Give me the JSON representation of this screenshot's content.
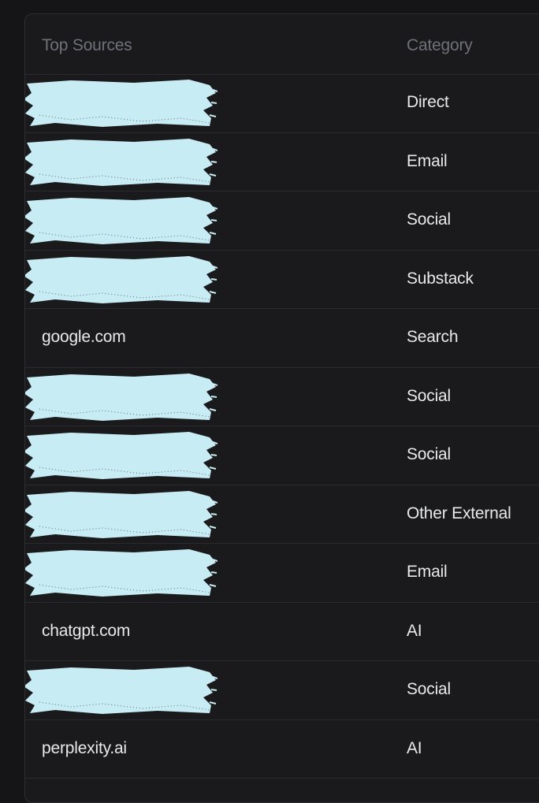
{
  "table": {
    "headers": {
      "source": "Top Sources",
      "category": "Category"
    },
    "rows": [
      {
        "source": "",
        "redacted": true,
        "category": "Direct"
      },
      {
        "source": "",
        "redacted": true,
        "category": "Email"
      },
      {
        "source": "",
        "redacted": true,
        "category": "Social"
      },
      {
        "source": "",
        "redacted": true,
        "category": "Substack"
      },
      {
        "source": "google.com",
        "redacted": false,
        "category": "Search"
      },
      {
        "source": "",
        "redacted": true,
        "category": "Social"
      },
      {
        "source": "",
        "redacted": true,
        "category": "Social"
      },
      {
        "source": "",
        "redacted": true,
        "category": "Other External"
      },
      {
        "source": "",
        "redacted": true,
        "category": "Email"
      },
      {
        "source": "chatgpt.com",
        "redacted": false,
        "category": "AI"
      },
      {
        "source": "",
        "redacted": true,
        "category": "Social"
      },
      {
        "source": "perplexity.ai",
        "redacted": false,
        "category": "AI"
      }
    ]
  },
  "colors": {
    "background": "#151517",
    "panel": "#1a1a1d",
    "divider": "#2b2c30",
    "header_text": "#6e7178",
    "cell_text": "#e8e9ec",
    "redaction": "#c8ecf4"
  }
}
